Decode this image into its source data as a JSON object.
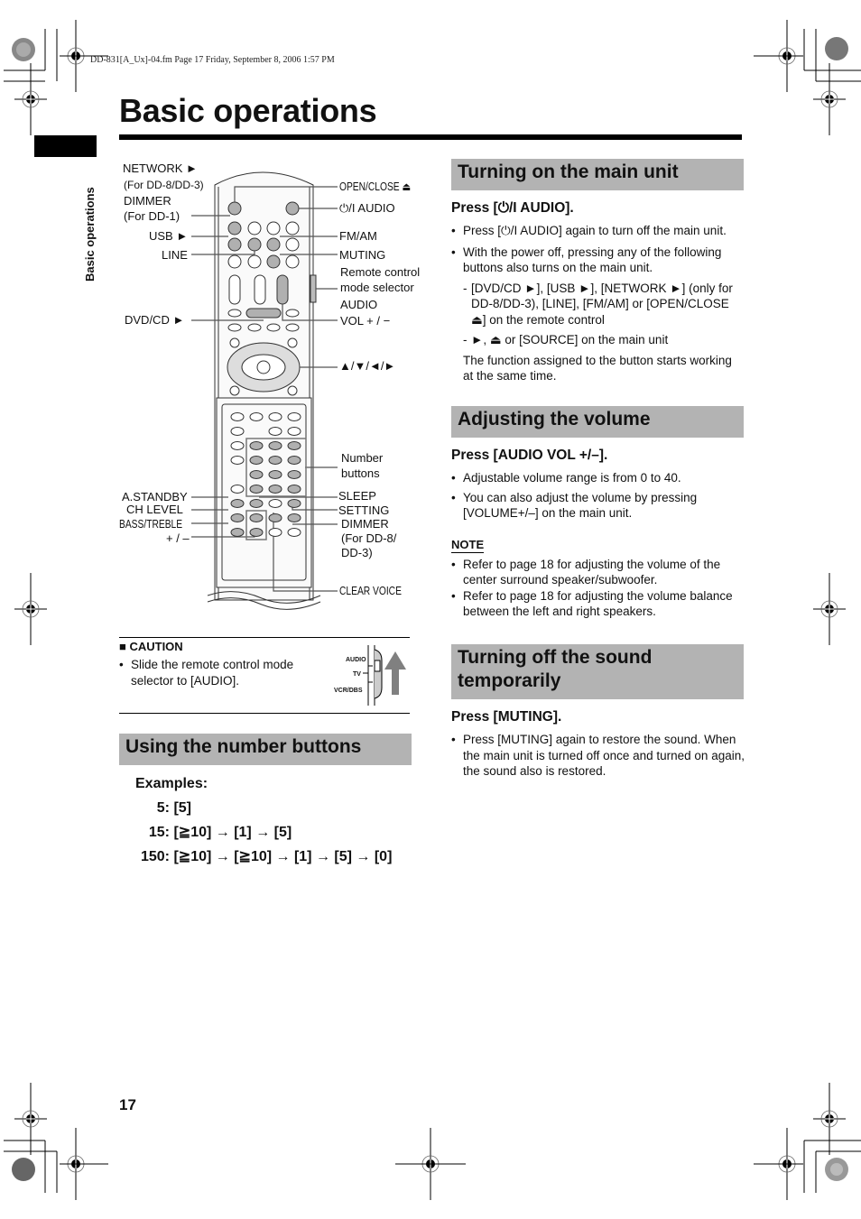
{
  "print_header": "DD-831[A_Ux]-04.fm  Page 17  Friday, September 8, 2006  1:57 PM",
  "page_title": "Basic operations",
  "side_tab_label": "Basic operations",
  "page_number": "17",
  "remote_diagram": {
    "left_labels": {
      "network": "NETWORK ►",
      "network_note": "(For DD-8/DD-3)",
      "dimmer": "DIMMER",
      "dimmer_note": "(For DD-1)",
      "usb": "USB ►",
      "line": "LINE",
      "dvdcd": "DVD/CD ►",
      "astandby": "A.STANDBY",
      "chlevel": "CH LEVEL",
      "basstreble": "BASS/TREBLE",
      "plusminus": "+ / –"
    },
    "right_labels": {
      "openclose": "OPEN/CLOSE ⏏",
      "power_audio": "⏻/I  AUDIO",
      "fmam": "FM/AM",
      "muting": "MUTING",
      "mode_selector_1": "Remote control",
      "mode_selector_2": "mode selector",
      "audio_vol_1": "AUDIO",
      "audio_vol_2": "VOL  + / −",
      "cursor": "▲/▼/◄/►",
      "number_1": "Number",
      "number_2": "buttons",
      "sleep": "SLEEP",
      "setting": "SETTING",
      "dimmer2_1": "DIMMER",
      "dimmer2_2": "(For DD-8/",
      "dimmer2_3": "DD-3)",
      "clearvoice": "CLEAR VOICE"
    }
  },
  "caution": {
    "title": "■ CAUTION",
    "text": "Slide the remote control mode selector to [AUDIO].",
    "selector_labels": [
      "AUDIO",
      "TV",
      "VCR/DBS"
    ]
  },
  "number_buttons": {
    "heading": "Using the number buttons",
    "examples_label": "Examples:",
    "examples": [
      {
        "num": "5:",
        "seq": "[5]"
      },
      {
        "num": "15:",
        "seq": "[≧10] → [1] → [5]"
      },
      {
        "num": "150:",
        "seq": "[≧10] → [≧10] → [1] → [5] → [0]"
      }
    ]
  },
  "turning_on": {
    "heading": "Turning on the main unit",
    "press": "Press [⏻/I AUDIO].",
    "bullets": [
      "Press [⏻/I AUDIO] again to turn off the main unit.",
      "With the power off, pressing any of the following buttons also turns on the main unit."
    ],
    "subitems": [
      "[DVD/CD ►], [USB ►], [NETWORK ►] (only for DD-8/DD-3), [LINE], [FM/AM] or [OPEN/CLOSE ⏏] on the remote control",
      "►, ⏏ or [SOURCE] on the main unit"
    ],
    "footer": "The function assigned to the button starts working at the same time."
  },
  "volume": {
    "heading": "Adjusting the volume",
    "press": "Press [AUDIO VOL +/–].",
    "bullets": [
      "Adjustable volume range is from 0 to 40.",
      "You can also adjust the volume by pressing [VOLUME+/–] on the main unit."
    ],
    "note_title": "NOTE",
    "notes": [
      "Refer to page 18 for adjusting the volume of the center surround speaker/subwoofer.",
      "Refer to page 18 for adjusting the volume balance between the left and right speakers."
    ]
  },
  "muting": {
    "heading_1": "Turning off the sound",
    "heading_2": "temporarily",
    "press": "Press [MUTING].",
    "bullets": [
      "Press [MUTING] again to restore the sound. When the main unit is turned off once and turned on again, the sound also is restored."
    ]
  }
}
